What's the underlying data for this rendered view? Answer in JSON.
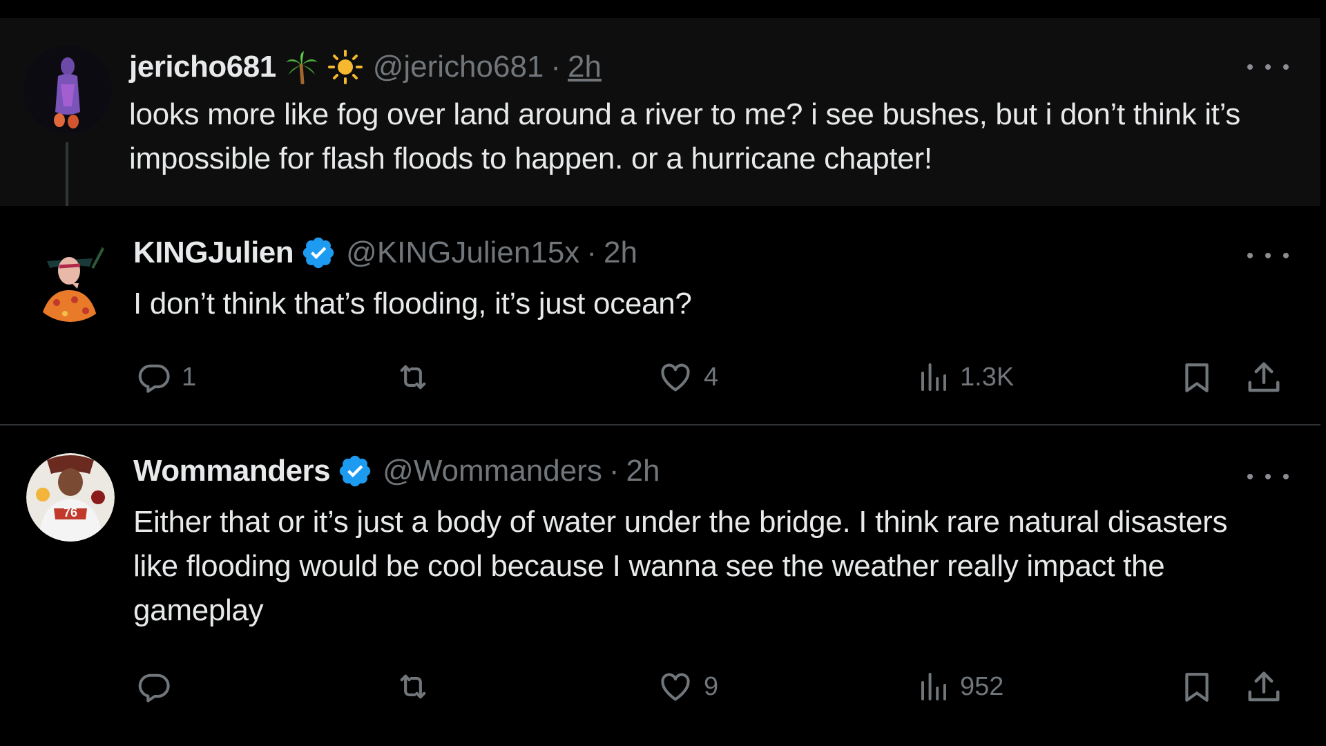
{
  "tweets": [
    {
      "name": "jericho681",
      "emojis": [
        "palm-tree",
        "sun"
      ],
      "handle": "@jericho681",
      "separator": "·",
      "time": "2h",
      "text": "looks more like fog over land around a river to me? i see bushes, but i don’t think it’s impossible for flash floods to happen. or a hurricane chapter!"
    },
    {
      "name": "KINGJulien",
      "verified": true,
      "handle": "@KINGJulien15x",
      "separator": "·",
      "time": "2h",
      "text": "I don’t think that’s flooding, it’s just ocean?",
      "actions": {
        "replies": "1",
        "reposts": "",
        "likes": "4",
        "views": "1.3K"
      }
    },
    {
      "name": "Wommanders",
      "verified": true,
      "handle": "@Wommanders",
      "separator": "·",
      "time": "2h",
      "text": "Either that or it’s just a body of water under the bridge. I think rare natural disasters like flooding would be cool because I wanna see the weather really impact the gameplay",
      "actions": {
        "replies": "",
        "reposts": "",
        "likes": "9",
        "views": "952"
      }
    }
  ],
  "icons": {
    "reply": "reply-icon",
    "repost": "repost-icon",
    "like": "heart-icon",
    "views": "views-icon",
    "bookmark": "bookmark-icon",
    "share": "share-icon",
    "more": "more-icon",
    "verified": "verified-badge-icon"
  },
  "colors": {
    "background": "#000000",
    "highlight_background": "#0e0e0e",
    "text": "#e7e9ea",
    "muted": "#71767b",
    "verified": "#1d9bf0",
    "divider": "#2f3336"
  }
}
